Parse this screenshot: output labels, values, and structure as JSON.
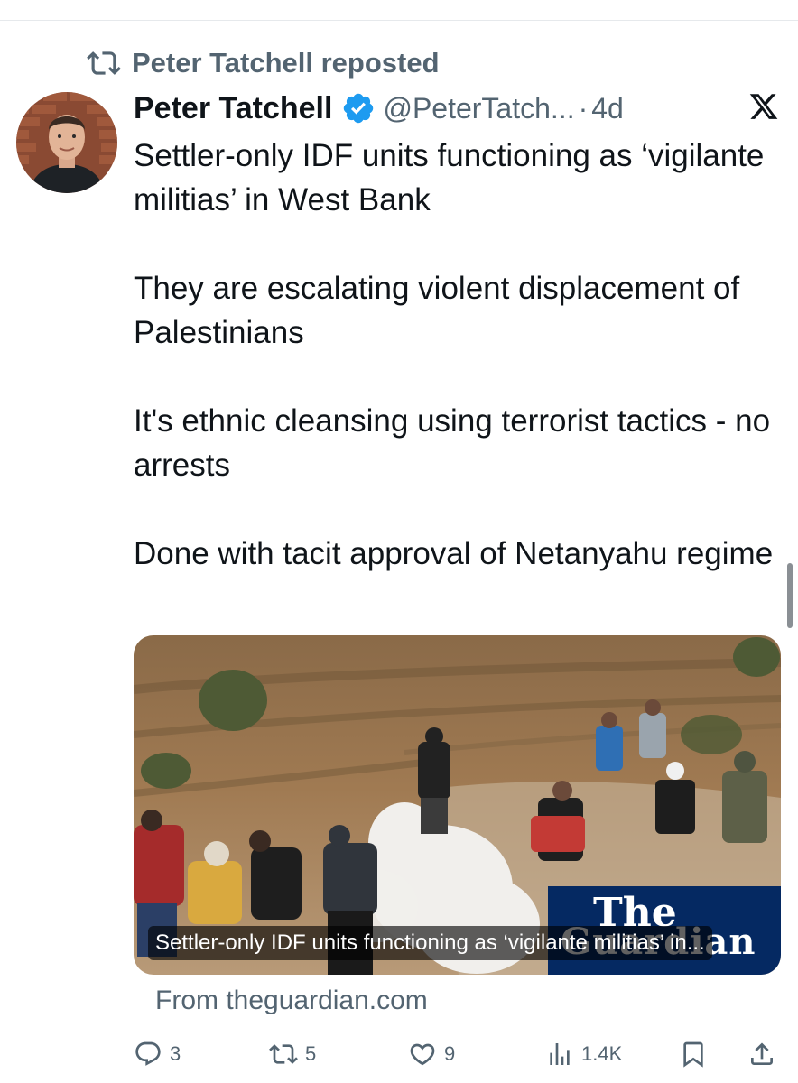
{
  "repost": {
    "label": "Peter Tatchell reposted",
    "icon": "repost-icon"
  },
  "author": {
    "name": "Peter Tatchell",
    "handle": "@PeterTatch...",
    "separator": "·",
    "time": "4d",
    "verified": true
  },
  "tweet": {
    "paragraphs": [
      "Settler-only IDF units functioning as ‘vigilante militias’ in West Bank",
      "They are escalating violent displacement of Palestinians",
      "It's ethnic cleansing using terrorist tactics - no arrests",
      "Done with tacit approval of Netanyahu regime"
    ]
  },
  "card": {
    "caption": "Settler-only IDF units functioning as ‘vigilante militias’ in...",
    "publisher_logo_line1": "The",
    "publisher_logo_line2": "Guardian",
    "source": "From theguardian.com"
  },
  "actions": {
    "replies": "3",
    "reposts": "5",
    "likes": "9",
    "views": "1.4K"
  },
  "colors": {
    "text": "#0f1419",
    "secondary": "#536471",
    "verified_blue": "#1d9bf0",
    "guardian_navy": "#052962"
  }
}
